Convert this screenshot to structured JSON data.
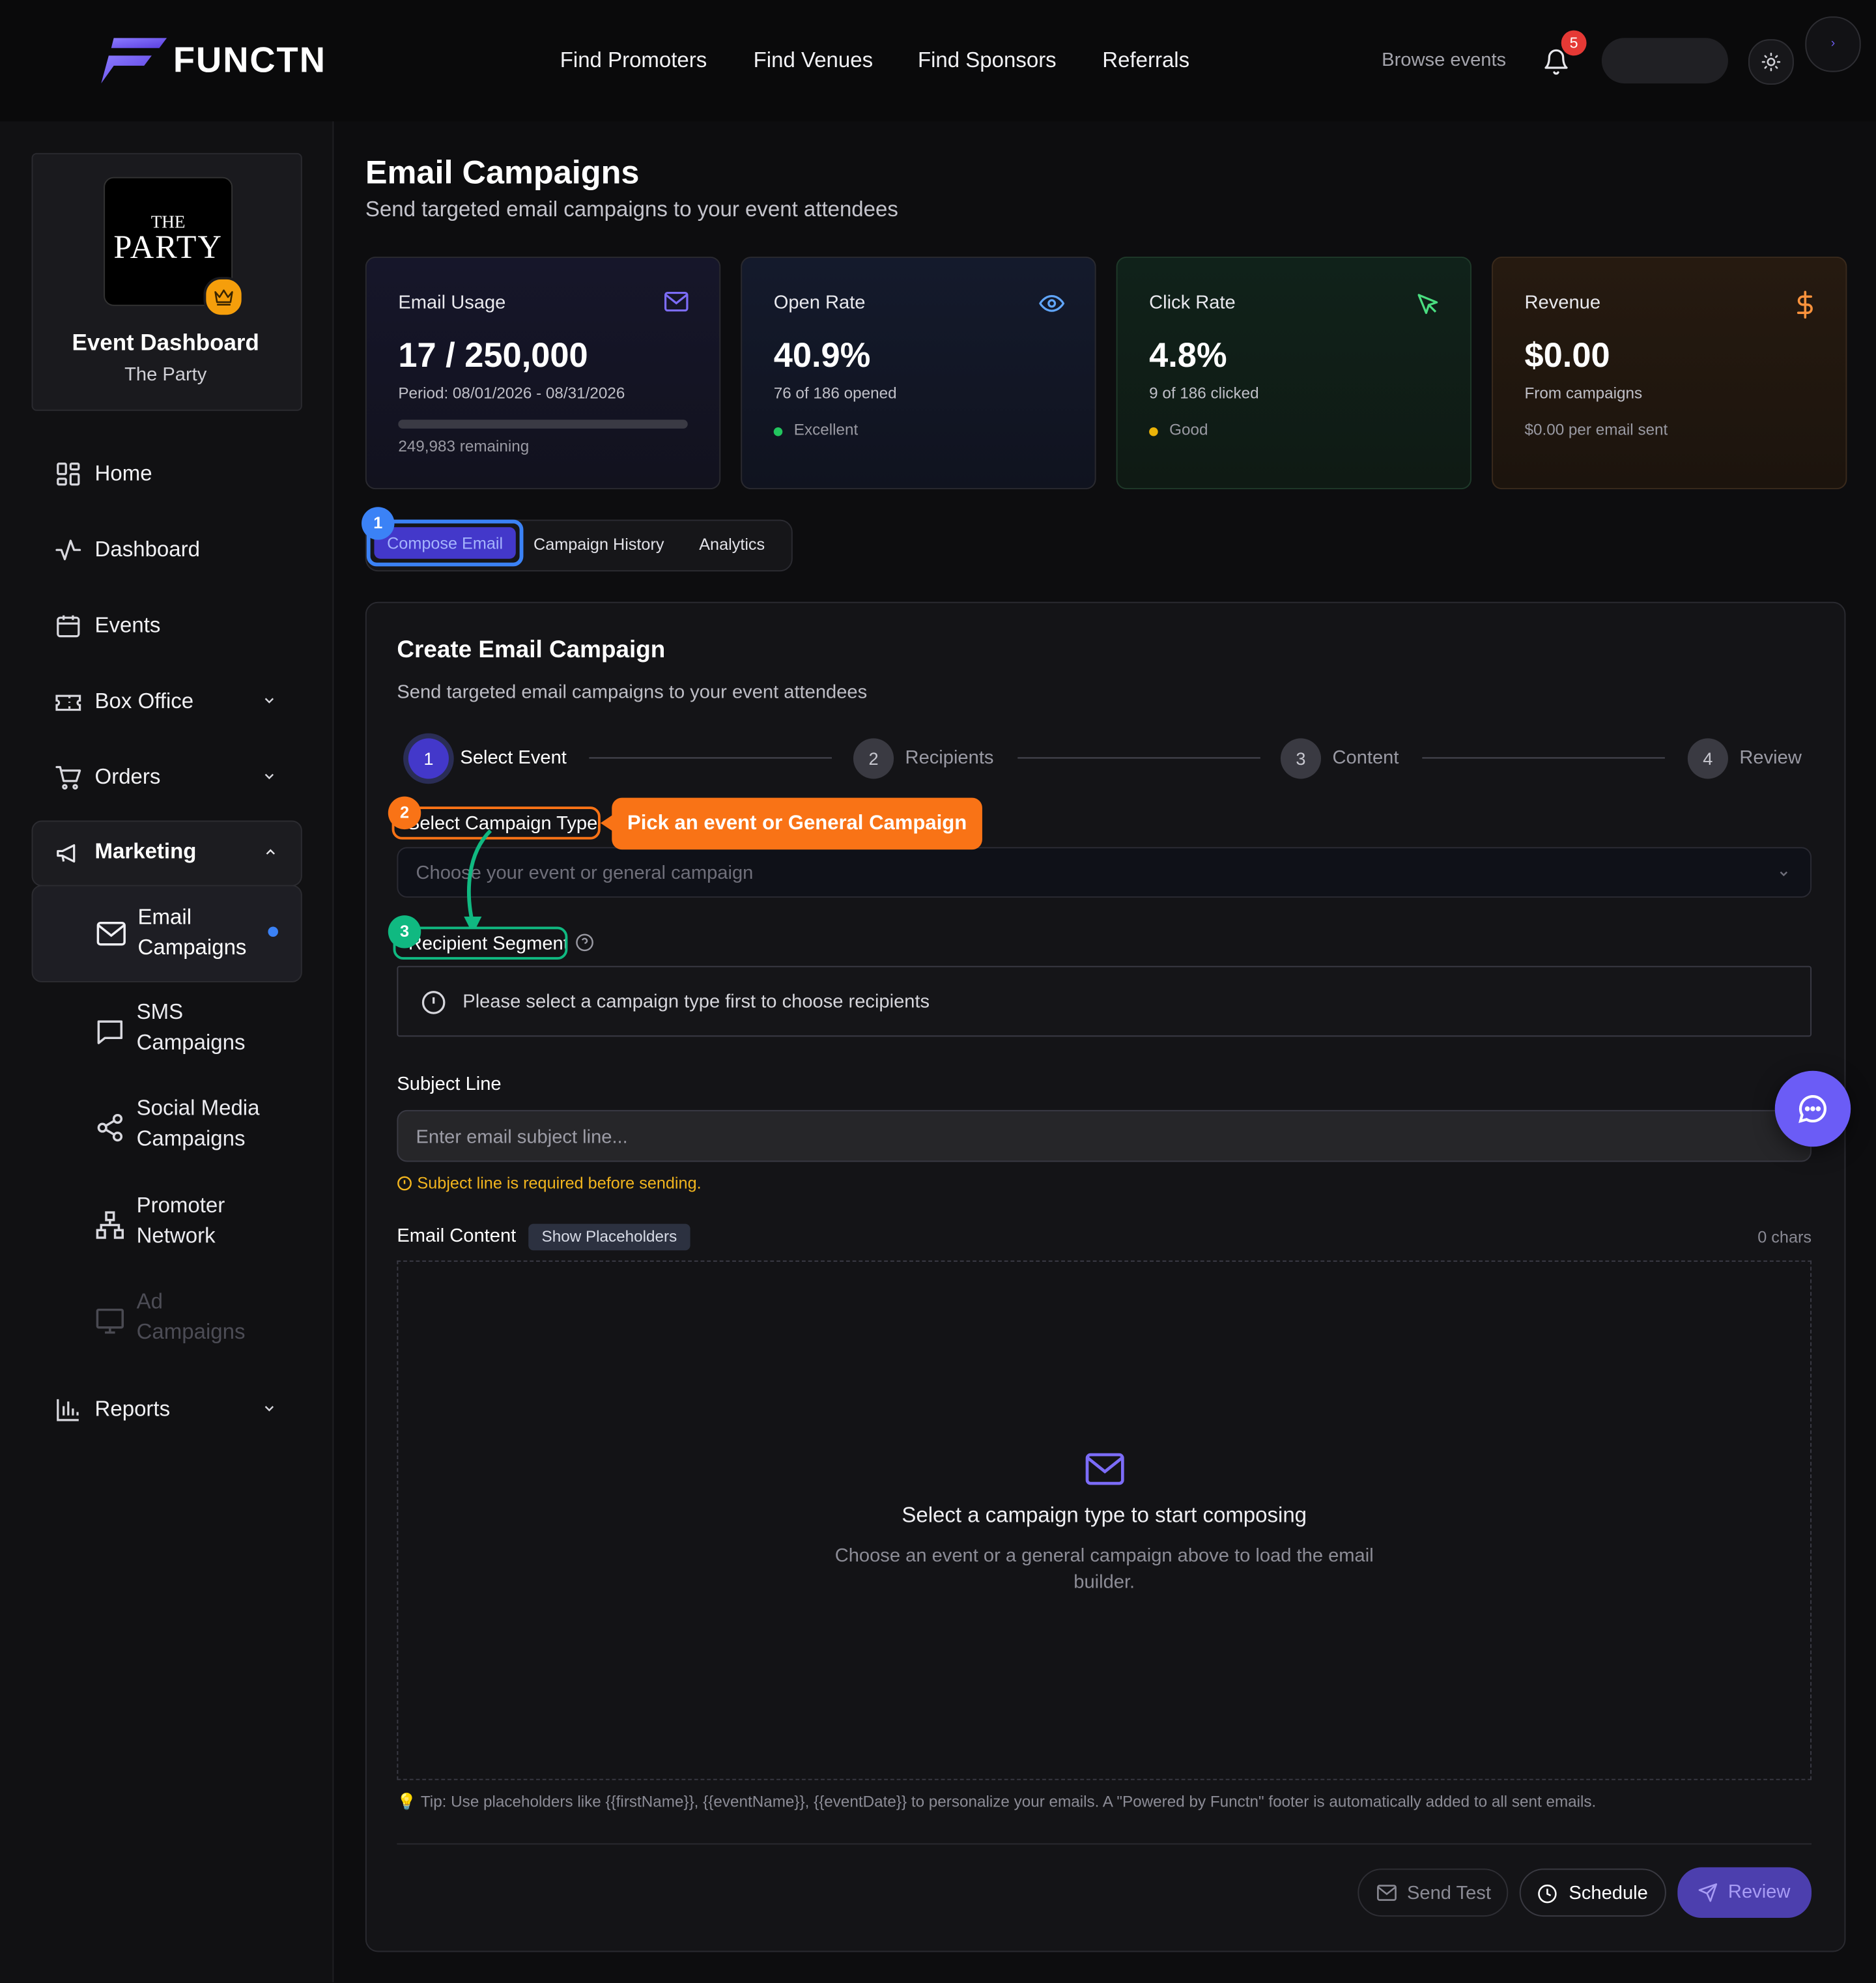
{
  "brand": {
    "name": "FUNCTN"
  },
  "topnav": {
    "links": [
      "Find Promoters",
      "Find Venues",
      "Find Sponsors",
      "Referrals"
    ],
    "browse": "Browse events",
    "notif_count": "5"
  },
  "sidebar": {
    "event_logo": {
      "line1": "THE",
      "line2": "PARTY"
    },
    "event_title": "Event Dashboard",
    "event_name": "The Party",
    "items": [
      {
        "label": "Home"
      },
      {
        "label": "Dashboard"
      },
      {
        "label": "Events"
      },
      {
        "label": "Box Office"
      },
      {
        "label": "Orders"
      },
      {
        "label": "Marketing"
      },
      {
        "label": "Reports"
      }
    ],
    "marketing_sub": [
      {
        "line1": "Email",
        "line2": "Campaigns"
      },
      {
        "line1": "SMS",
        "line2": "Campaigns"
      },
      {
        "line1": "Social Media",
        "line2": "Campaigns"
      },
      {
        "line1": "Promoter",
        "line2": "Network"
      },
      {
        "line1": "Ad",
        "line2": "Campaigns"
      }
    ]
  },
  "page": {
    "title": "Email Campaigns",
    "subtitle": "Send targeted email campaigns to your event attendees"
  },
  "stats": [
    {
      "title": "Email Usage",
      "value": "17 / 250,000",
      "sub": "Period: 08/01/2026 - 08/31/2026",
      "extra": "249,983 remaining",
      "usage_fraction": 6.8e-05
    },
    {
      "title": "Open Rate",
      "value": "40.9%",
      "sub": "76 of 186 opened",
      "extra": "Excellent",
      "dot_color": "#22c55e"
    },
    {
      "title": "Click Rate",
      "value": "4.8%",
      "sub": "9 of 186 clicked",
      "extra": "Good",
      "dot_color": "#eab308"
    },
    {
      "title": "Revenue",
      "value": "$0.00",
      "sub": "From campaigns",
      "extra": "$0.00 per email sent"
    }
  ],
  "tabs": [
    "Compose Email",
    "Campaign History",
    "Analytics"
  ],
  "guide": {
    "badge1": "1",
    "badge2": "2",
    "badge3": "3",
    "tooltip": "Pick an event or General Campaign"
  },
  "compose": {
    "title": "Create Email Campaign",
    "subtitle": "Send targeted email campaigns to your event attendees",
    "steps": [
      {
        "num": "1",
        "label": "Select Event"
      },
      {
        "num": "2",
        "label": "Recipients"
      },
      {
        "num": "3",
        "label": "Content"
      },
      {
        "num": "4",
        "label": "Review"
      }
    ],
    "campaign_type_label": "Select Campaign Type",
    "campaign_type_placeholder": "Choose your event or general campaign",
    "segment_label": "Recipient Segment",
    "segment_notice": "Please select a campaign type first to choose recipients",
    "subject_label": "Subject Line",
    "subject_placeholder": "Enter email subject line...",
    "subject_warning": "Subject line is required before sending.",
    "content_label": "Email Content",
    "placeholders_button": "Show Placeholders",
    "char_count": "0 chars",
    "empty_title": "Select a campaign type to start composing",
    "empty_sub": "Choose an event or a general campaign above to load the email builder.",
    "tip": "💡 Tip: Use placeholders like {{firstName}}, {{eventName}}, {{eventDate}} to personalize your emails. A \"Powered by Functn\" footer is automatically added to all sent emails.",
    "buttons": {
      "send_test": "Send Test",
      "schedule": "Schedule",
      "review": "Review"
    }
  },
  "colors": {
    "accent": "#6b5cf6",
    "guide_blue": "#3b82f6",
    "guide_orange": "#f97316",
    "guide_green": "#10b981",
    "warning": "#f2b51e"
  }
}
